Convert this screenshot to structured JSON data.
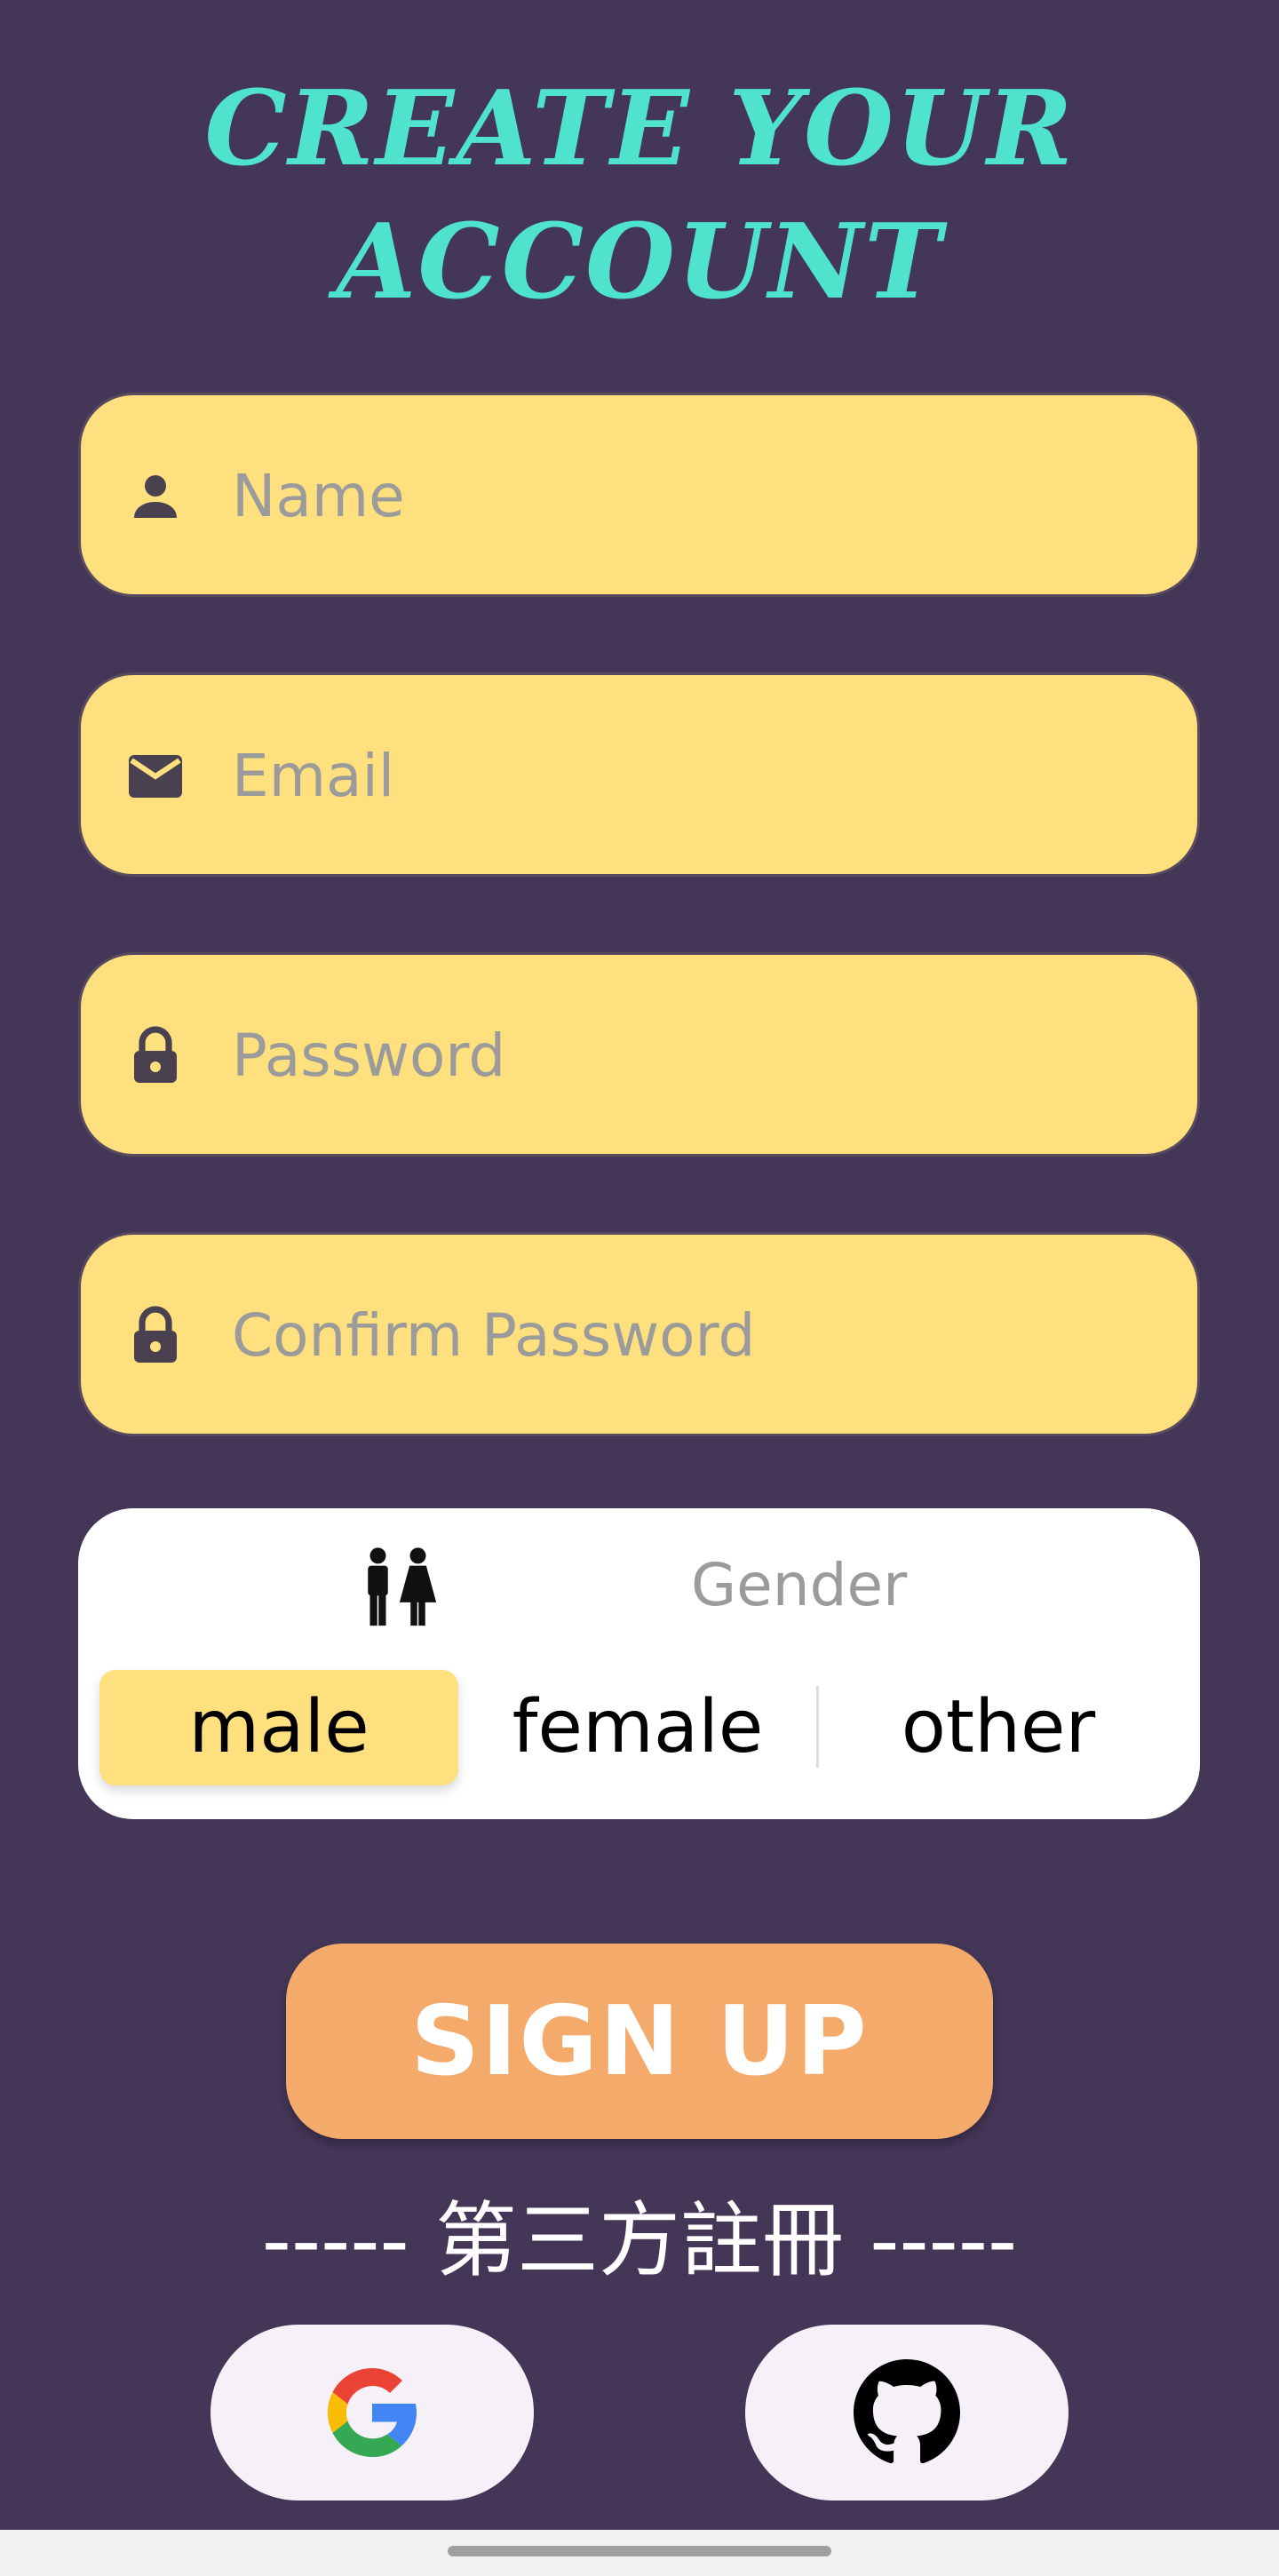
{
  "title": {
    "line1": "CREATE YOUR",
    "line2": "ACCOUNT"
  },
  "fields": [
    {
      "placeholder": "Name",
      "icon": "person-icon"
    },
    {
      "placeholder": "Email",
      "icon": "email-icon"
    },
    {
      "placeholder": "Password",
      "icon": "lock-icon"
    },
    {
      "placeholder": "Confirm Password",
      "icon": "lock-icon"
    }
  ],
  "gender": {
    "label": "Gender",
    "icon": "wc-icon",
    "options": [
      "male",
      "female",
      "other"
    ],
    "selected": "male"
  },
  "signup_label": "SIGN UP",
  "third_party_label": "----- 第三方註冊 -----",
  "social": [
    {
      "icon": "google-icon"
    },
    {
      "icon": "github-icon"
    }
  ],
  "colors": {
    "background": "#433657",
    "title": "#4fe3cc",
    "field": "#ffe07e",
    "signup": "#f4aa6b",
    "card": "#ffffff"
  }
}
